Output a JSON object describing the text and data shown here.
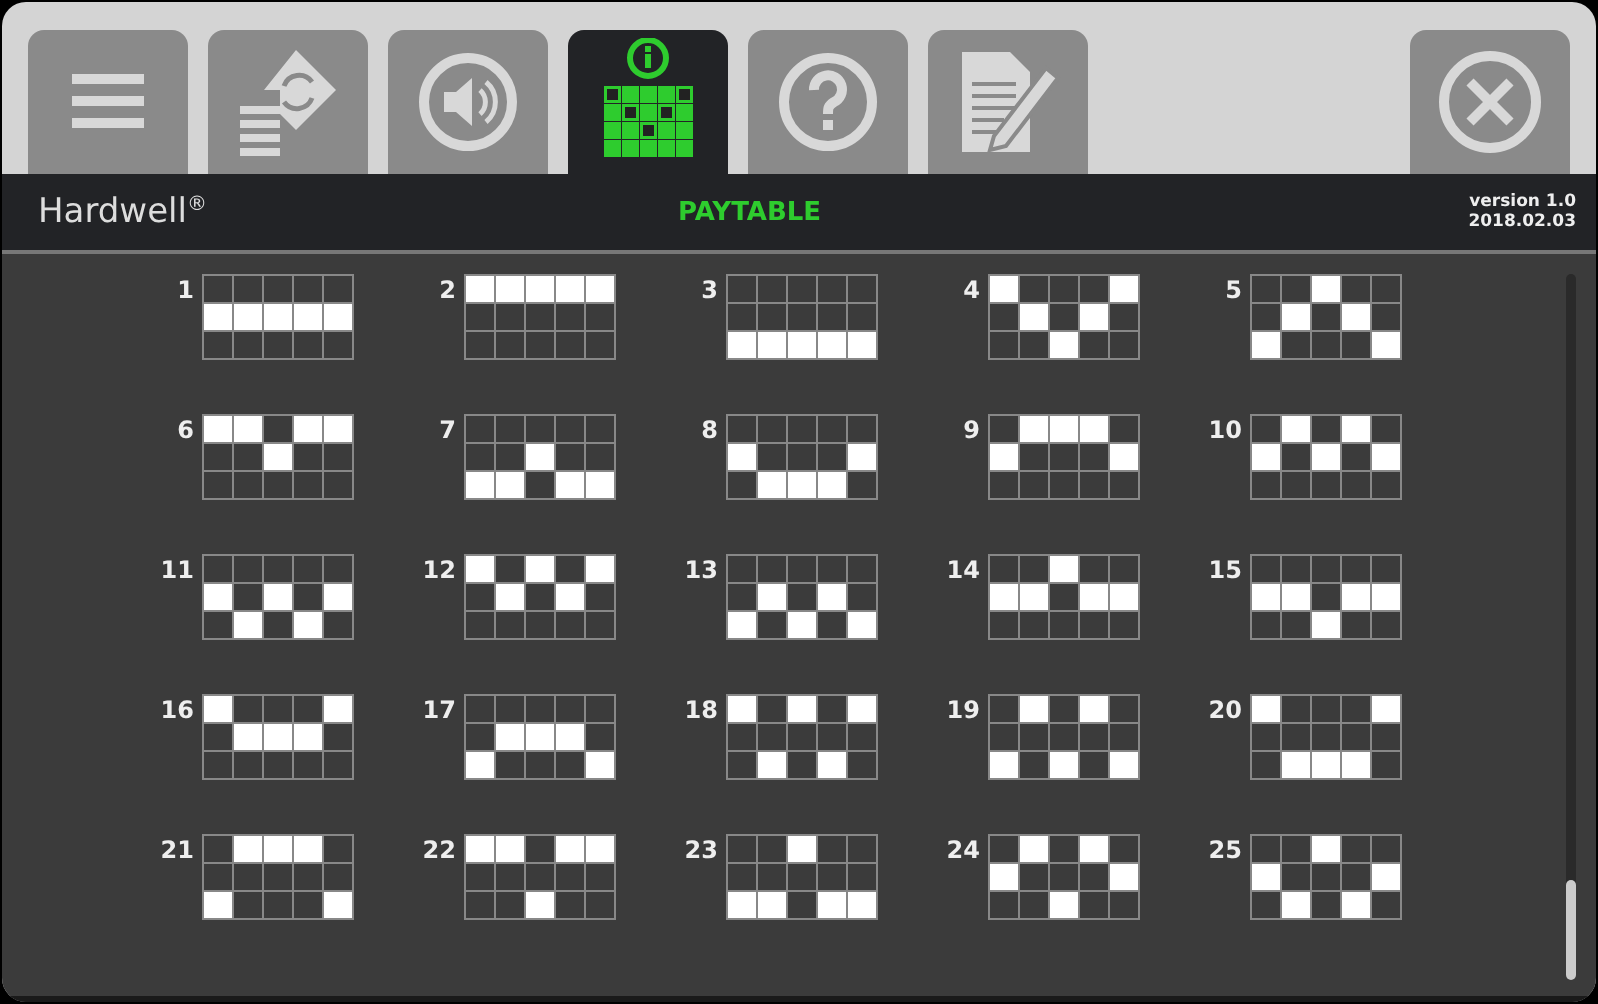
{
  "tabs": [
    {
      "kind": "menu",
      "selected": false
    },
    {
      "kind": "bets",
      "selected": false
    },
    {
      "kind": "sound",
      "selected": false
    },
    {
      "kind": "paytable",
      "selected": true
    },
    {
      "kind": "help",
      "selected": false
    },
    {
      "kind": "notes",
      "selected": false
    }
  ],
  "close": {
    "kind": "close"
  },
  "header": {
    "brand": "Hardwell$^{®}$",
    "title": "PAYTABLE",
    "version": "version 1.0",
    "date": "2018.02.03"
  },
  "lines": [
    {
      "number": "1",
      "lit": [
        [
          false,
          false,
          false,
          false,
          false
        ],
        [
          true,
          true,
          true,
          true,
          true
        ],
        [
          false,
          false,
          false,
          false,
          false
        ]
      ]
    },
    {
      "number": "2",
      "lit": [
        [
          true,
          true,
          true,
          true,
          true
        ],
        [
          false,
          false,
          false,
          false,
          false
        ],
        [
          false,
          false,
          false,
          false,
          false
        ]
      ]
    },
    {
      "number": "3",
      "lit": [
        [
          false,
          false,
          false,
          false,
          false
        ],
        [
          false,
          false,
          false,
          false,
          false
        ],
        [
          true,
          true,
          true,
          true,
          true
        ]
      ]
    },
    {
      "number": "4",
      "lit": [
        [
          true,
          false,
          false,
          false,
          true
        ],
        [
          false,
          true,
          false,
          true,
          false
        ],
        [
          false,
          false,
          true,
          false,
          false
        ]
      ]
    },
    {
      "number": "5",
      "lit": [
        [
          false,
          false,
          true,
          false,
          false
        ],
        [
          false,
          true,
          false,
          true,
          false
        ],
        [
          true,
          false,
          false,
          false,
          true
        ]
      ]
    },
    {
      "number": "6",
      "lit": [
        [
          true,
          true,
          false,
          true,
          true
        ],
        [
          false,
          false,
          true,
          false,
          false
        ],
        [
          false,
          false,
          false,
          false,
          false
        ]
      ]
    },
    {
      "number": "7",
      "lit": [
        [
          false,
          false,
          false,
          false,
          false
        ],
        [
          false,
          false,
          true,
          false,
          false
        ],
        [
          true,
          true,
          false,
          true,
          true
        ]
      ]
    },
    {
      "number": "8",
      "lit": [
        [
          false,
          false,
          false,
          false,
          false
        ],
        [
          true,
          false,
          false,
          false,
          true
        ],
        [
          false,
          true,
          true,
          true,
          false
        ]
      ]
    },
    {
      "number": "9",
      "lit": [
        [
          false,
          true,
          true,
          true,
          false
        ],
        [
          true,
          false,
          false,
          false,
          true
        ],
        [
          false,
          false,
          false,
          false,
          false
        ]
      ]
    },
    {
      "number": "10",
      "lit": [
        [
          false,
          true,
          false,
          true,
          false
        ],
        [
          true,
          false,
          true,
          false,
          true
        ],
        [
          false,
          false,
          false,
          false,
          false
        ]
      ]
    },
    {
      "number": "11",
      "lit": [
        [
          false,
          false,
          false,
          false,
          false
        ],
        [
          true,
          false,
          true,
          false,
          true
        ],
        [
          false,
          true,
          false,
          true,
          false
        ]
      ]
    },
    {
      "number": "12",
      "lit": [
        [
          true,
          false,
          true,
          false,
          true
        ],
        [
          false,
          true,
          false,
          true,
          false
        ],
        [
          false,
          false,
          false,
          false,
          false
        ]
      ]
    },
    {
      "number": "13",
      "lit": [
        [
          false,
          false,
          false,
          false,
          false
        ],
        [
          false,
          true,
          false,
          true,
          false
        ],
        [
          true,
          false,
          true,
          false,
          true
        ]
      ]
    },
    {
      "number": "14",
      "lit": [
        [
          false,
          false,
          true,
          false,
          false
        ],
        [
          true,
          true,
          false,
          true,
          true
        ],
        [
          false,
          false,
          false,
          false,
          false
        ]
      ]
    },
    {
      "number": "15",
      "lit": [
        [
          false,
          false,
          false,
          false,
          false
        ],
        [
          true,
          true,
          false,
          true,
          true
        ],
        [
          false,
          false,
          true,
          false,
          false
        ]
      ]
    },
    {
      "number": "16",
      "lit": [
        [
          true,
          false,
          false,
          false,
          true
        ],
        [
          false,
          true,
          true,
          true,
          false
        ],
        [
          false,
          false,
          false,
          false,
          false
        ]
      ]
    },
    {
      "number": "17",
      "lit": [
        [
          false,
          false,
          false,
          false,
          false
        ],
        [
          false,
          true,
          true,
          true,
          false
        ],
        [
          true,
          false,
          false,
          false,
          true
        ]
      ]
    },
    {
      "number": "18",
      "lit": [
        [
          true,
          false,
          true,
          false,
          true
        ],
        [
          false,
          false,
          false,
          false,
          false
        ],
        [
          false,
          true,
          false,
          true,
          false
        ]
      ]
    },
    {
      "number": "19",
      "lit": [
        [
          false,
          true,
          false,
          true,
          false
        ],
        [
          false,
          false,
          false,
          false,
          false
        ],
        [
          true,
          false,
          true,
          false,
          true
        ]
      ]
    },
    {
      "number": "20",
      "lit": [
        [
          true,
          false,
          false,
          false,
          true
        ],
        [
          false,
          false,
          false,
          false,
          false
        ],
        [
          false,
          true,
          true,
          true,
          false
        ]
      ]
    },
    {
      "number": "21",
      "lit": [
        [
          false,
          true,
          true,
          true,
          false
        ],
        [
          false,
          false,
          false,
          false,
          false
        ],
        [
          true,
          false,
          false,
          false,
          true
        ]
      ]
    },
    {
      "number": "22",
      "lit": [
        [
          true,
          true,
          false,
          true,
          true
        ],
        [
          false,
          false,
          false,
          false,
          false
        ],
        [
          false,
          false,
          true,
          false,
          false
        ]
      ]
    },
    {
      "number": "23",
      "lit": [
        [
          false,
          false,
          true,
          false,
          false
        ],
        [
          false,
          false,
          false,
          false,
          false
        ],
        [
          true,
          true,
          false,
          true,
          true
        ]
      ]
    },
    {
      "number": "24",
      "lit": [
        [
          false,
          true,
          false,
          true,
          false
        ],
        [
          true,
          false,
          false,
          false,
          true
        ],
        [
          false,
          false,
          true,
          false,
          false
        ]
      ]
    },
    {
      "number": "25",
      "lit": [
        [
          false,
          false,
          true,
          false,
          false
        ],
        [
          true,
          false,
          false,
          false,
          true
        ],
        [
          false,
          true,
          false,
          true,
          false
        ]
      ]
    }
  ]
}
